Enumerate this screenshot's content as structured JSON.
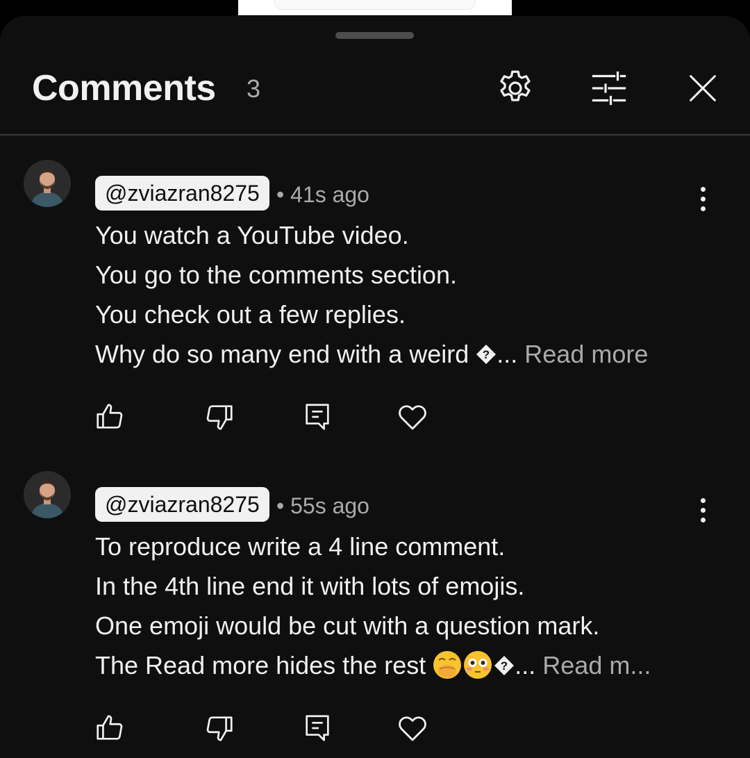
{
  "header": {
    "title": "Comments",
    "count": "3"
  },
  "comments": [
    {
      "author": "@zviazran8275",
      "time": "• 41s ago",
      "lines": [
        "You watch a YouTube video.",
        "You go to the comments section.",
        "You check out a few replies.",
        "Why do so many end with a weird "
      ],
      "truncation": "...",
      "read_more": "Read more"
    },
    {
      "author": "@zviazran8275",
      "time": "• 55s ago",
      "lines": [
        "To reproduce write a 4 line comment.",
        "In the 4th line end it with lots of emojis.",
        "One emoji would be cut with a question mark.",
        "The Read more hides the rest "
      ],
      "truncation": "...",
      "read_more": "Read m..."
    }
  ],
  "icons": {
    "settings": "gear-icon",
    "filter": "sliders-icon",
    "close": "close-icon",
    "like": "thumbs-up-icon",
    "dislike": "thumbs-down-icon",
    "reply": "reply-icon",
    "heart": "heart-icon",
    "more": "more-vert-icon"
  },
  "colors": {
    "background": "#0f0f0f",
    "text": "#f1f1f1",
    "muted": "#aaaaaa",
    "divider": "#3a3a3a"
  }
}
